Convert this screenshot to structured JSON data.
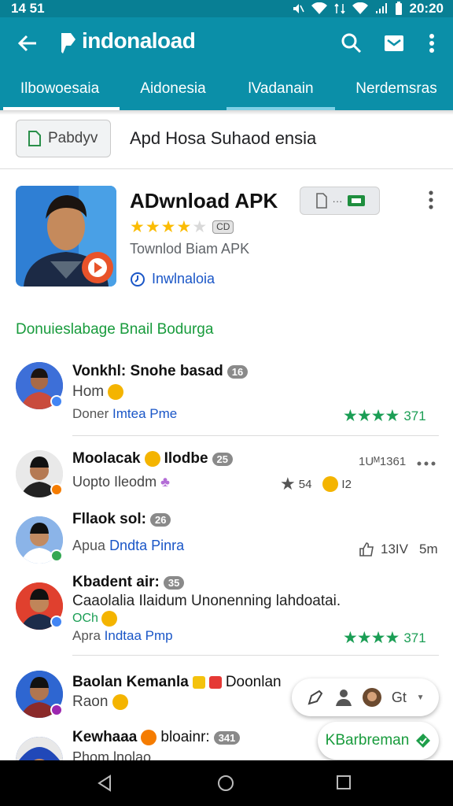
{
  "status": {
    "time": "14 51",
    "clock": "20:20"
  },
  "appbar": {
    "title": "indonaload",
    "back_icon": "back-arrow-icon",
    "actions": [
      "search-icon",
      "mail-icon",
      "more-vert-icon"
    ],
    "brand_color": "#0b8fa8"
  },
  "tabs": [
    {
      "label": "Ilbowoesaia"
    },
    {
      "label": "Aidonesia"
    },
    {
      "label": "lVadanain"
    },
    {
      "label": "Nerdemsras"
    }
  ],
  "filter": {
    "button_label": "Pabdyv",
    "text": "Apd Hosa Suhaod ensia"
  },
  "app": {
    "name": "ADwnload APK",
    "rating_stars": 4,
    "rating_badge": "CD",
    "subtitle": "Townlod Biam APK",
    "link": "Inwlnaloia"
  },
  "section_title": "Donuieslabage Bnail Bodurga",
  "reviews": [
    {
      "name": "Vonkhl: Snohe basad",
      "count": "16",
      "line2": "Hom",
      "meta_prefix": "Doner",
      "meta_link": "Imtea Pme",
      "rating": "371"
    },
    {
      "name": "Moolacak",
      "name2": "Ilodbe",
      "count": "25",
      "line2": "Uopto Ileodm",
      "date": "1Uᴹ1361",
      "count_a": "54",
      "count_b": "I2"
    },
    {
      "name": "Fllaok sol:",
      "count": "26",
      "line2_prefix": "Apua",
      "line2_link": "Dndta Pinra",
      "likes": "13IV",
      "time": "5m"
    },
    {
      "name": "Kbadent air:",
      "count": "35",
      "line2": "Caaolalia Ilaidum Unonenning lahdoatai.",
      "line3": "OCh",
      "meta_prefix": "Apra",
      "meta_link": "Indtaa Pmp",
      "rating": "371"
    },
    {
      "name": "Baolan Kemanla",
      "name2": "Doonlan",
      "line2": "Raon"
    },
    {
      "name": "Kewhaaa",
      "name2": "bloainr:",
      "count": "341",
      "line2": "Phom lnolao"
    }
  ],
  "fab": {
    "label": "Gt"
  },
  "chip": {
    "label": "KBarbreman"
  }
}
